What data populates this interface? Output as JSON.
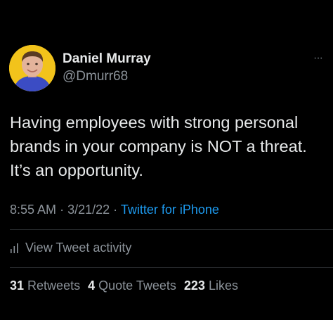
{
  "author": {
    "display_name": "Daniel Murray",
    "handle": "@Dmurr68",
    "avatar_icon": "avatar-photo",
    "avatar_bg": "#f2c31b"
  },
  "menu": {
    "icon": "more-icon",
    "glyph": "···"
  },
  "tweet": {
    "text": "Having employees with strong personal brands in your company is NOT a threat. It’s an opportunity.",
    "time": "8:55 AM",
    "date": "3/21/22",
    "separator": "·",
    "source": "Twitter for iPhone"
  },
  "activity": {
    "icon": "bar-chart-icon",
    "label": "View Tweet activity"
  },
  "stats": [
    {
      "count": "31",
      "label": "Retweets"
    },
    {
      "count": "4",
      "label": "Quote Tweets"
    },
    {
      "count": "223",
      "label": "Likes"
    }
  ],
  "colors": {
    "background": "#000000",
    "primary_text": "#e7e9ea",
    "secondary_text": "#8b9299",
    "link": "#1d9bf0",
    "divider": "#2a2d30"
  }
}
